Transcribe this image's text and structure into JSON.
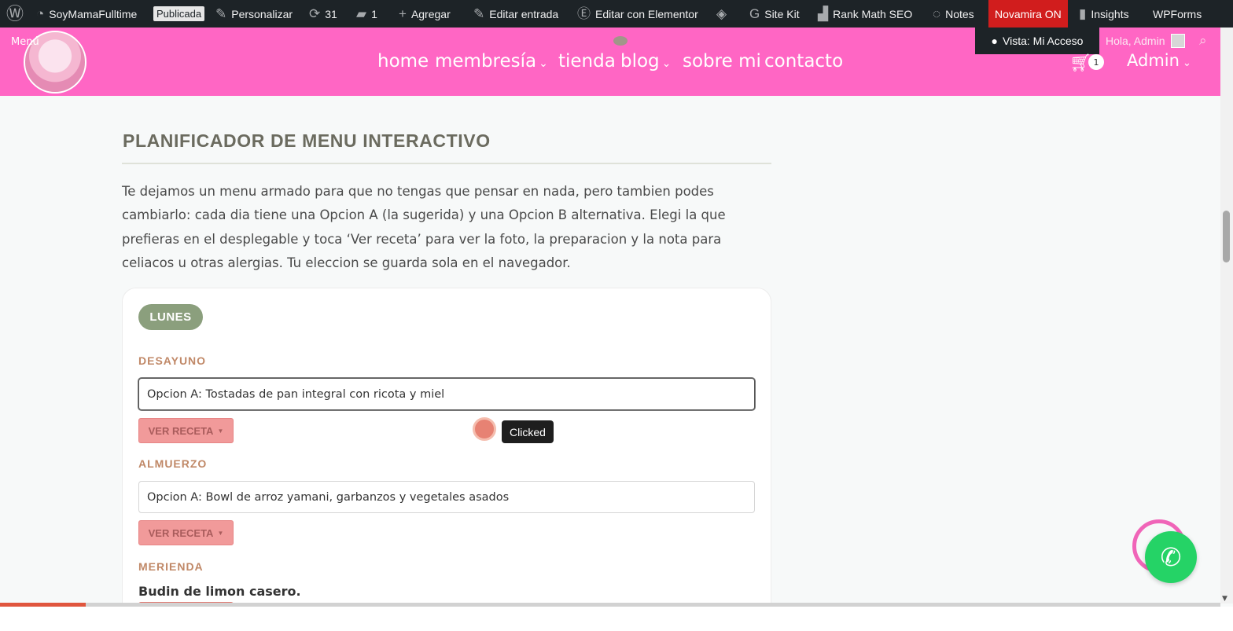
{
  "admin_bar": {
    "site_name": "SoyMamaFulltime",
    "status_pill": "Publicada",
    "customize": "Personalizar",
    "updates_count": "31",
    "comments_count": "1",
    "add_new": "Agregar",
    "edit_post": "Editar entrada",
    "edit_elementor": "Editar con Elementor",
    "site_kit": "Site Kit",
    "rank_math": "Rank Math SEO",
    "notes": "Notes",
    "novamira": "Novamira ON",
    "insights": "Insights",
    "wpforms": "WPForms"
  },
  "header": {
    "menu_mini": "Menú",
    "nav": {
      "home": "home",
      "membership": "membresía",
      "shop": "tienda",
      "blog": "blog",
      "about": "sobre mi",
      "contact": "contacto"
    },
    "view_as": "Vista: Mi Acceso",
    "greeting": "Hola, Admin",
    "cart_count": "1",
    "admin_menu": "Admin"
  },
  "content": {
    "title": "PLANIFICADOR DE MENU INTERACTIVO",
    "intro": "Te dejamos un menu armado para que no tengas que pensar en nada, pero tambien podes cambiarlo: cada dia tiene una Opcion A (la sugerida) y una Opcion B alternativa. Elegi la que prefieras en el desplegable y toca ‘Ver receta’ para ver la foto, la preparacion y la nota para celiacos u otras alergias. Tu eleccion se guarda sola en el navegador.",
    "day": "LUNES",
    "meals": {
      "breakfast_label": "DESAYUNO",
      "breakfast_value": "Opcion A: Tostadas de pan integral con ricota y miel",
      "lunch_label": "ALMUERZO",
      "lunch_value": "Opcion A: Bowl de arroz yamani, garbanzos y vegetales asados",
      "snack_label": "MERIENDA",
      "snack_value": "Budin de limon casero."
    },
    "recipe_button": "VER RECETA"
  },
  "overlay": {
    "clicked_label": "Clicked"
  },
  "reading_progress_percent": 7,
  "colors": {
    "header_pink": "#ff66c4",
    "admin_bar": "#1d2327",
    "day_badge": "#8b9f7d",
    "recipe_button": "#f19a9a",
    "meal_label": "#c08867",
    "whatsapp": "#25d366",
    "novamira": "#d11d1d"
  },
  "icons": {
    "wp": "wordpress-icon",
    "cart": "cart-icon",
    "search": "search-icon",
    "whatsapp": "whatsapp-icon"
  }
}
